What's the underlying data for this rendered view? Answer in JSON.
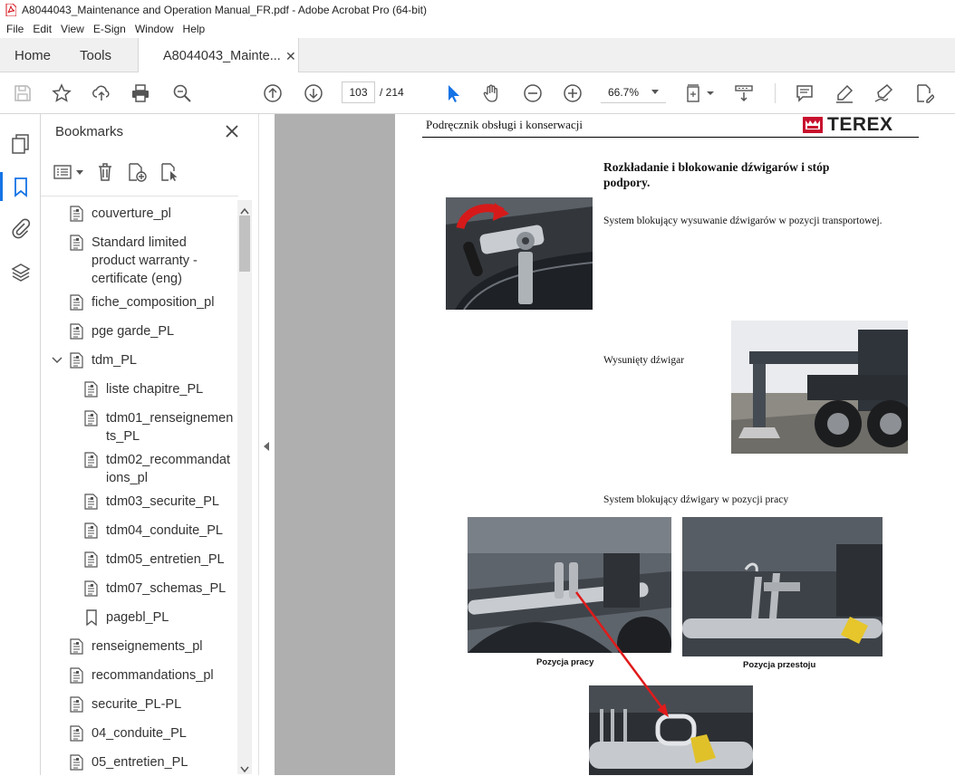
{
  "window": {
    "title": "A8044043_Maintenance and Operation Manual_FR.pdf - Adobe Acrobat Pro (64-bit)"
  },
  "menu": [
    "File",
    "Edit",
    "View",
    "E-Sign",
    "Window",
    "Help"
  ],
  "tabs": {
    "home": "Home",
    "tools": "Tools",
    "document": "A8044043_Mainte..."
  },
  "toolbar": {
    "page_current": "103",
    "page_total": "/ 214",
    "zoom": "66.7%"
  },
  "bookmarks_panel": {
    "title": "Bookmarks",
    "items": [
      {
        "label": "couverture_pl"
      },
      {
        "label": "Standard limited\nproduct warranty -\ncertificate (eng)"
      },
      {
        "label": "fiche_composition_pl"
      },
      {
        "label": "pge garde_PL"
      },
      {
        "label": "tdm_PL"
      },
      {
        "label": "liste chapitre_PL"
      },
      {
        "label": "tdm01_renseignemen\nts_PL"
      },
      {
        "label": "tdm02_recommandat\nions_pl"
      },
      {
        "label": "tdm03_securite_PL"
      },
      {
        "label": "tdm04_conduite_PL"
      },
      {
        "label": "tdm05_entretien_PL"
      },
      {
        "label": "tdm07_schemas_PL"
      },
      {
        "label": "pagebl_PL"
      },
      {
        "label": "renseignements_pl"
      },
      {
        "label": "recommandations_pl"
      },
      {
        "label": "securite_PL-PL"
      },
      {
        "label": "04_conduite_PL"
      },
      {
        "label": "05_entretien_PL"
      }
    ]
  },
  "document_page": {
    "header": "Podręcznik obsługi i konserwacji",
    "brand": "TEREX",
    "section_title": "Rozkładanie i blokowanie dźwigarów i stóp podpory.",
    "text_transport": "System blokujący wysuwanie dźwigarów w pozycji transportowej.",
    "text_extended": "Wysunięty dźwigar",
    "text_work_lock": "System blokujący dźwigary w pozycji pracy",
    "caption_work": "Pozycja pracy",
    "caption_rest": "Pozycja przestoju"
  },
  "colors": {
    "accent": "#1473e6",
    "brand_red": "#c8102e",
    "canvas": "#afafaf",
    "arrow": "#e01b1b"
  }
}
